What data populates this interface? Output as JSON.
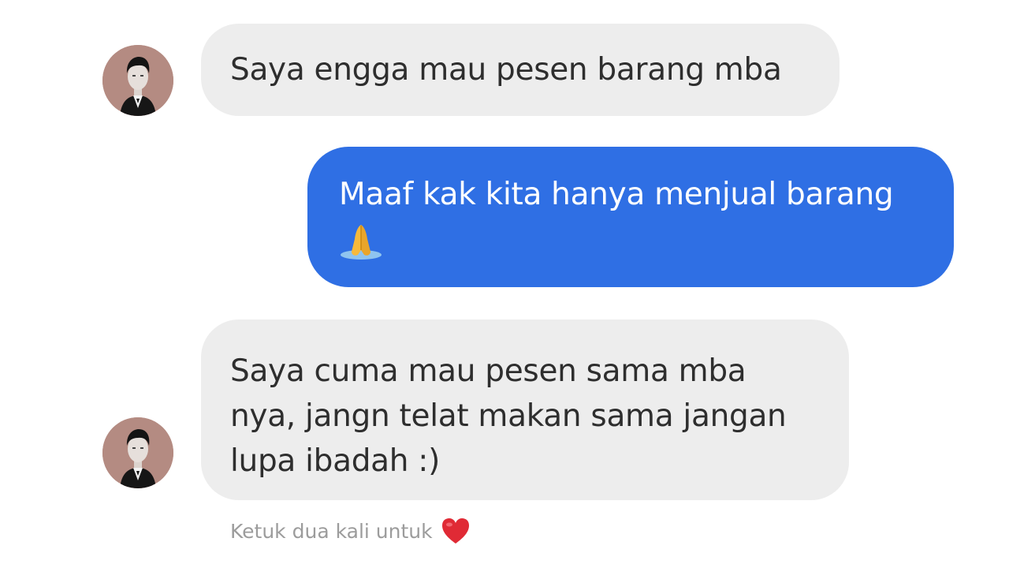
{
  "conversation": {
    "messages": [
      {
        "direction": "incoming",
        "lines": [
          "Saya engga mau pesen barang mba"
        ]
      },
      {
        "direction": "outgoing",
        "lines": [
          "Maaf kak kita hanya menjual barang"
        ],
        "emoji": "folded-hands-icon"
      },
      {
        "direction": "incoming",
        "lines": [
          "Saya cuma mau pesen sama mba",
          "nya, jangn telat makan sama jangan",
          "lupa ibadah :)"
        ]
      }
    ],
    "hint": {
      "text": "Ketuk dua kali untuk",
      "icon": "red-heart-icon"
    }
  },
  "colors": {
    "incoming_bubble": "#ededed",
    "outgoing_bubble": "#2f6fe4",
    "outgoing_text": "#ffffff",
    "hint_text": "#9c9c9c",
    "heart": "#e02a35"
  }
}
